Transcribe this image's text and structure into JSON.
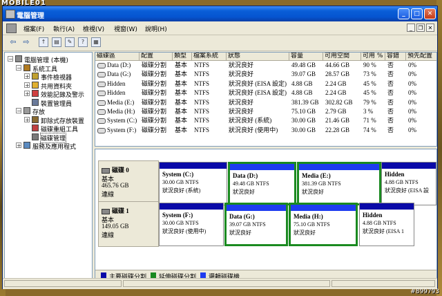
{
  "watermark": {
    "logo": "MOBILE01",
    "post_id": "#899793"
  },
  "window": {
    "title": "電腦管理"
  },
  "menu": [
    "檔案(F)",
    "執行(A)",
    "檢視(V)",
    "視窗(W)",
    "說明(H)"
  ],
  "title_buttons": {
    "minimize": "_",
    "maximize": "□",
    "close": "✕"
  },
  "mdi_buttons": {
    "minimize": "_",
    "restore": "❐",
    "close": "✕"
  },
  "tree": [
    {
      "label": "電腦管理 (本機)",
      "expander": "−",
      "icon": "computer-management-icon",
      "depth": 0
    },
    {
      "label": "系統工具",
      "expander": "−",
      "icon": "system-tools-icon",
      "depth": 1
    },
    {
      "label": "事件檢視器",
      "expander": "+",
      "icon": "event-viewer-icon",
      "depth": 2
    },
    {
      "label": "共用資料夾",
      "expander": "+",
      "icon": "shared-folders-icon",
      "depth": 2
    },
    {
      "label": "效能記錄及警示",
      "expander": "+",
      "icon": "performance-logs-icon",
      "depth": 2
    },
    {
      "label": "裝置管理員",
      "expander": "",
      "icon": "device-manager-icon",
      "depth": 2
    },
    {
      "label": "存放",
      "expander": "−",
      "icon": "storage-icon",
      "depth": 1
    },
    {
      "label": "卸除式存放裝置",
      "expander": "+",
      "icon": "removable-storage-icon",
      "depth": 2
    },
    {
      "label": "磁碟重組工具",
      "expander": "",
      "icon": "defragmenter-icon",
      "depth": 2
    },
    {
      "label": "磁碟管理",
      "expander": "",
      "icon": "disk-management-icon",
      "depth": 2,
      "selected": true
    },
    {
      "label": "服務及應用程式",
      "expander": "+",
      "icon": "services-applications-icon",
      "depth": 1
    }
  ],
  "volume_list": {
    "columns": [
      "磁碟區",
      "配置",
      "類型",
      "檔案系統",
      "狀態",
      "容量",
      "可用空間",
      "可用 %",
      "容錯",
      "預先配置"
    ],
    "rows": [
      [
        "Data (D:)",
        "磁碟分割",
        "基本",
        "NTFS",
        "狀況良好",
        "49.48 GB",
        "44.66 GB",
        "90 %",
        "否",
        "0%"
      ],
      [
        "Data (G:)",
        "磁碟分割",
        "基本",
        "NTFS",
        "狀況良好",
        "39.07 GB",
        "28.57 GB",
        "73 %",
        "否",
        "0%"
      ],
      [
        "Hidden",
        "磁碟分割",
        "基本",
        "NTFS",
        "狀況良好 (EISA 設定)",
        "4.88 GB",
        "2.24 GB",
        "45 %",
        "否",
        "0%"
      ],
      [
        "Hidden",
        "磁碟分割",
        "基本",
        "NTFS",
        "狀況良好 (EISA 設定)",
        "4.88 GB",
        "2.24 GB",
        "45 %",
        "否",
        "0%"
      ],
      [
        "Media (E:)",
        "磁碟分割",
        "基本",
        "NTFS",
        "狀況良好",
        "381.39 GB",
        "302.82 GB",
        "79 %",
        "否",
        "0%"
      ],
      [
        "Media (H:)",
        "磁碟分割",
        "基本",
        "NTFS",
        "狀況良好",
        "75.10 GB",
        "2.79 GB",
        "3 %",
        "否",
        "0%"
      ],
      [
        "System (C:)",
        "磁碟分割",
        "基本",
        "NTFS",
        "狀況良好 (系統)",
        "30.00 GB",
        "21.46 GB",
        "71 %",
        "否",
        "0%"
      ],
      [
        "System (F:)",
        "磁碟分割",
        "基本",
        "NTFS",
        "狀況良好 (使用中)",
        "30.00 GB",
        "22.28 GB",
        "74 %",
        "否",
        "0%"
      ]
    ]
  },
  "disks": [
    {
      "name": "磁碟 0",
      "type": "基本",
      "size": "465.76 GB",
      "status": "連線",
      "partitions": [
        {
          "title": "System (C:)",
          "size": "30.00 GB NTFS",
          "status": "狀況良好 (系統)",
          "kind": "primary"
        },
        {
          "title": "Data (D:)",
          "size": "49.48 GB NTFS",
          "status": "狀況良好",
          "kind": "logical"
        },
        {
          "title": "Media (E:)",
          "size": "381.39 GB NTFS",
          "status": "狀況良好",
          "kind": "logical"
        },
        {
          "title": "Hidden",
          "size": "4.88 GB NTFS",
          "status": "狀況良好 (EISA 設",
          "kind": "primary"
        }
      ]
    },
    {
      "name": "磁碟 1",
      "type": "基本",
      "size": "149.05 GB",
      "status": "連線",
      "partitions": [
        {
          "title": "System (F:)",
          "size": "30.00 GB NTFS",
          "status": "狀況良好 (使用中)",
          "kind": "primary"
        },
        {
          "title": "Data (G:)",
          "size": "39.07 GB NTFS",
          "status": "狀況良好",
          "kind": "logical"
        },
        {
          "title": "Media (H:)",
          "size": "75.10 GB NTFS",
          "status": "狀況良好",
          "kind": "logical"
        },
        {
          "title": "Hidden",
          "size": "4.88 GB NTFS",
          "status": "狀況良好 (EISA 1",
          "kind": "primary"
        }
      ]
    }
  ],
  "legend": [
    {
      "label": "主要磁碟分割",
      "color": "#0a0aa8"
    },
    {
      "label": "延伸磁碟分割",
      "color": "#1a8a20"
    },
    {
      "label": "邏輯磁碟機",
      "color": "#1e3cf0"
    }
  ]
}
